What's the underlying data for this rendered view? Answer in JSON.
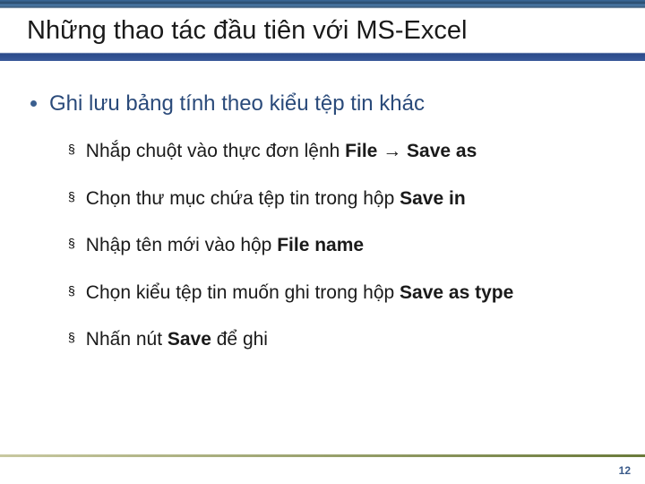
{
  "title": "Những thao tác đầu tiên với MS-Excel",
  "main_bullet": "Ghi lưu bảng tính theo kiểu tệp tin khác",
  "items": [
    {
      "pre": "Nhắp chuột vào thực đơn lệnh ",
      "b1": "File",
      "mid": " ",
      "arrow": "→",
      "mid2": " ",
      "b2": "Save as",
      "post": ""
    },
    {
      "pre": "Chọn thư mục chứa tệp tin trong hộp ",
      "b1": "Save in",
      "mid": "",
      "arrow": "",
      "mid2": "",
      "b2": "",
      "post": ""
    },
    {
      "pre": "Nhập tên mới vào hộp ",
      "b1": "File name",
      "mid": "",
      "arrow": "",
      "mid2": "",
      "b2": "",
      "post": ""
    },
    {
      "pre": "Chọn kiểu tệp tin muốn ghi trong hộp ",
      "b1": "Save as type",
      "mid": "",
      "arrow": "",
      "mid2": "",
      "b2": "",
      "post": ""
    },
    {
      "pre": "Nhấn nút ",
      "b1": "Save",
      "mid": " để ghi",
      "arrow": "",
      "mid2": "",
      "b2": "",
      "post": ""
    }
  ],
  "page_number": "12"
}
